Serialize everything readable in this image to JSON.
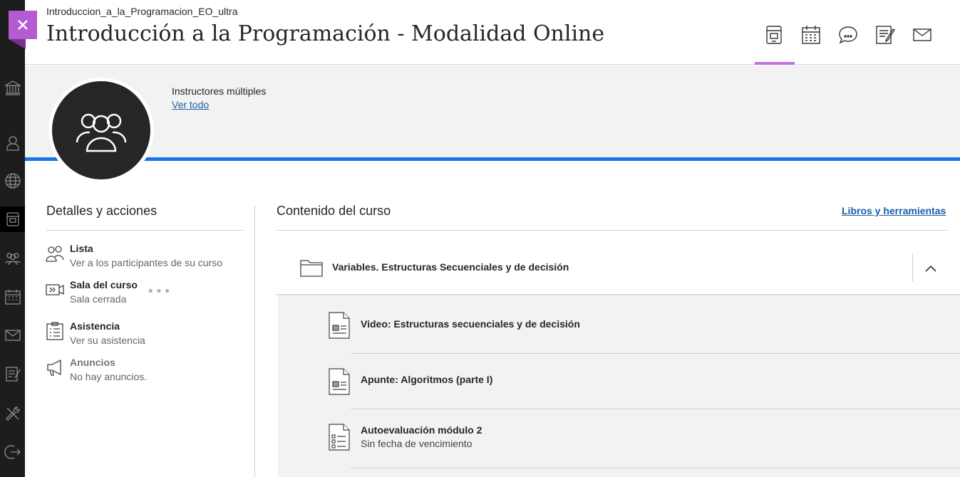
{
  "header": {
    "course_code": "Introduccion_a_la_Programacion_EO_ultra",
    "course_title": "Introducción a la Programación - Modalidad Online",
    "icons": [
      "content-icon",
      "calendar-icon",
      "discussions-icon",
      "gradebook-icon",
      "messages-icon"
    ],
    "active_tab": "content-icon",
    "accent_color": "#c174de"
  },
  "rail": {
    "icons": [
      "institution-icon",
      "profile-icon",
      "globe-icon",
      "courses-icon",
      "groups-icon",
      "calendar-icon",
      "messages-icon",
      "grades-icon",
      "tools-icon",
      "signout-icon"
    ],
    "active": "courses-icon"
  },
  "banner": {
    "instructors_label": "Instructores múltiples",
    "see_all_link": "Ver todo",
    "stripe_color": "#1c73e8"
  },
  "details": {
    "title": "Detalles y acciones",
    "items": [
      {
        "icon": "roster-icon",
        "title": "Lista",
        "subtitle": "Ver a los participantes de su curso"
      },
      {
        "icon": "course-room-icon",
        "title": "Sala del curso",
        "subtitle": "Sala cerrada"
      },
      {
        "icon": "attendance-icon",
        "title": "Asistencia",
        "subtitle": "Ver su asistencia"
      },
      {
        "icon": "announcements-icon",
        "title": "Anuncios",
        "subtitle": "No hay anuncios."
      }
    ]
  },
  "content": {
    "title": "Contenido del curso",
    "books_link": "Libros y herramientas",
    "folder": {
      "label": "Variables. Estructuras Secuenciales y de decisión",
      "icon": "folder-icon",
      "expanded": true
    },
    "items": [
      {
        "icon": "document-icon",
        "title": "Video: Estructuras secuenciales y de decisión",
        "subtitle": ""
      },
      {
        "icon": "document-icon",
        "title": "Apunte: Algoritmos (parte I)",
        "subtitle": ""
      },
      {
        "icon": "test-icon",
        "title": "Autoevaluación módulo 2",
        "subtitle": "Sin fecha de vencimiento"
      }
    ]
  }
}
